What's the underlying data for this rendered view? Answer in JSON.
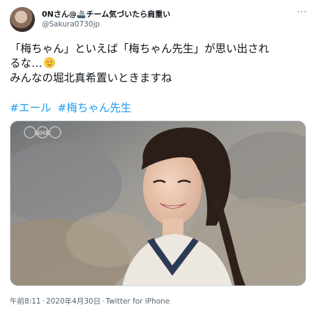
{
  "tweet": {
    "display_name": "0Nさん@🚢チーム気づいたら肩重い",
    "handle": "@Sakura0730jp",
    "more_label": "···",
    "text_lines": [
      "「梅ちゃん」といえば「梅ちゃん先生」が思い出され",
      "るな…",
      "みんなの堀北真希置いときますね"
    ],
    "emoji": "relieved-face",
    "hashtags": [
      "#エール",
      "#梅ちゃん先生"
    ],
    "media": {
      "watermark": "NHK"
    },
    "meta": {
      "time": "午前8:11",
      "separator": "·",
      "date": "2020年4月30日",
      "source": "Twitter for iPhone"
    }
  }
}
